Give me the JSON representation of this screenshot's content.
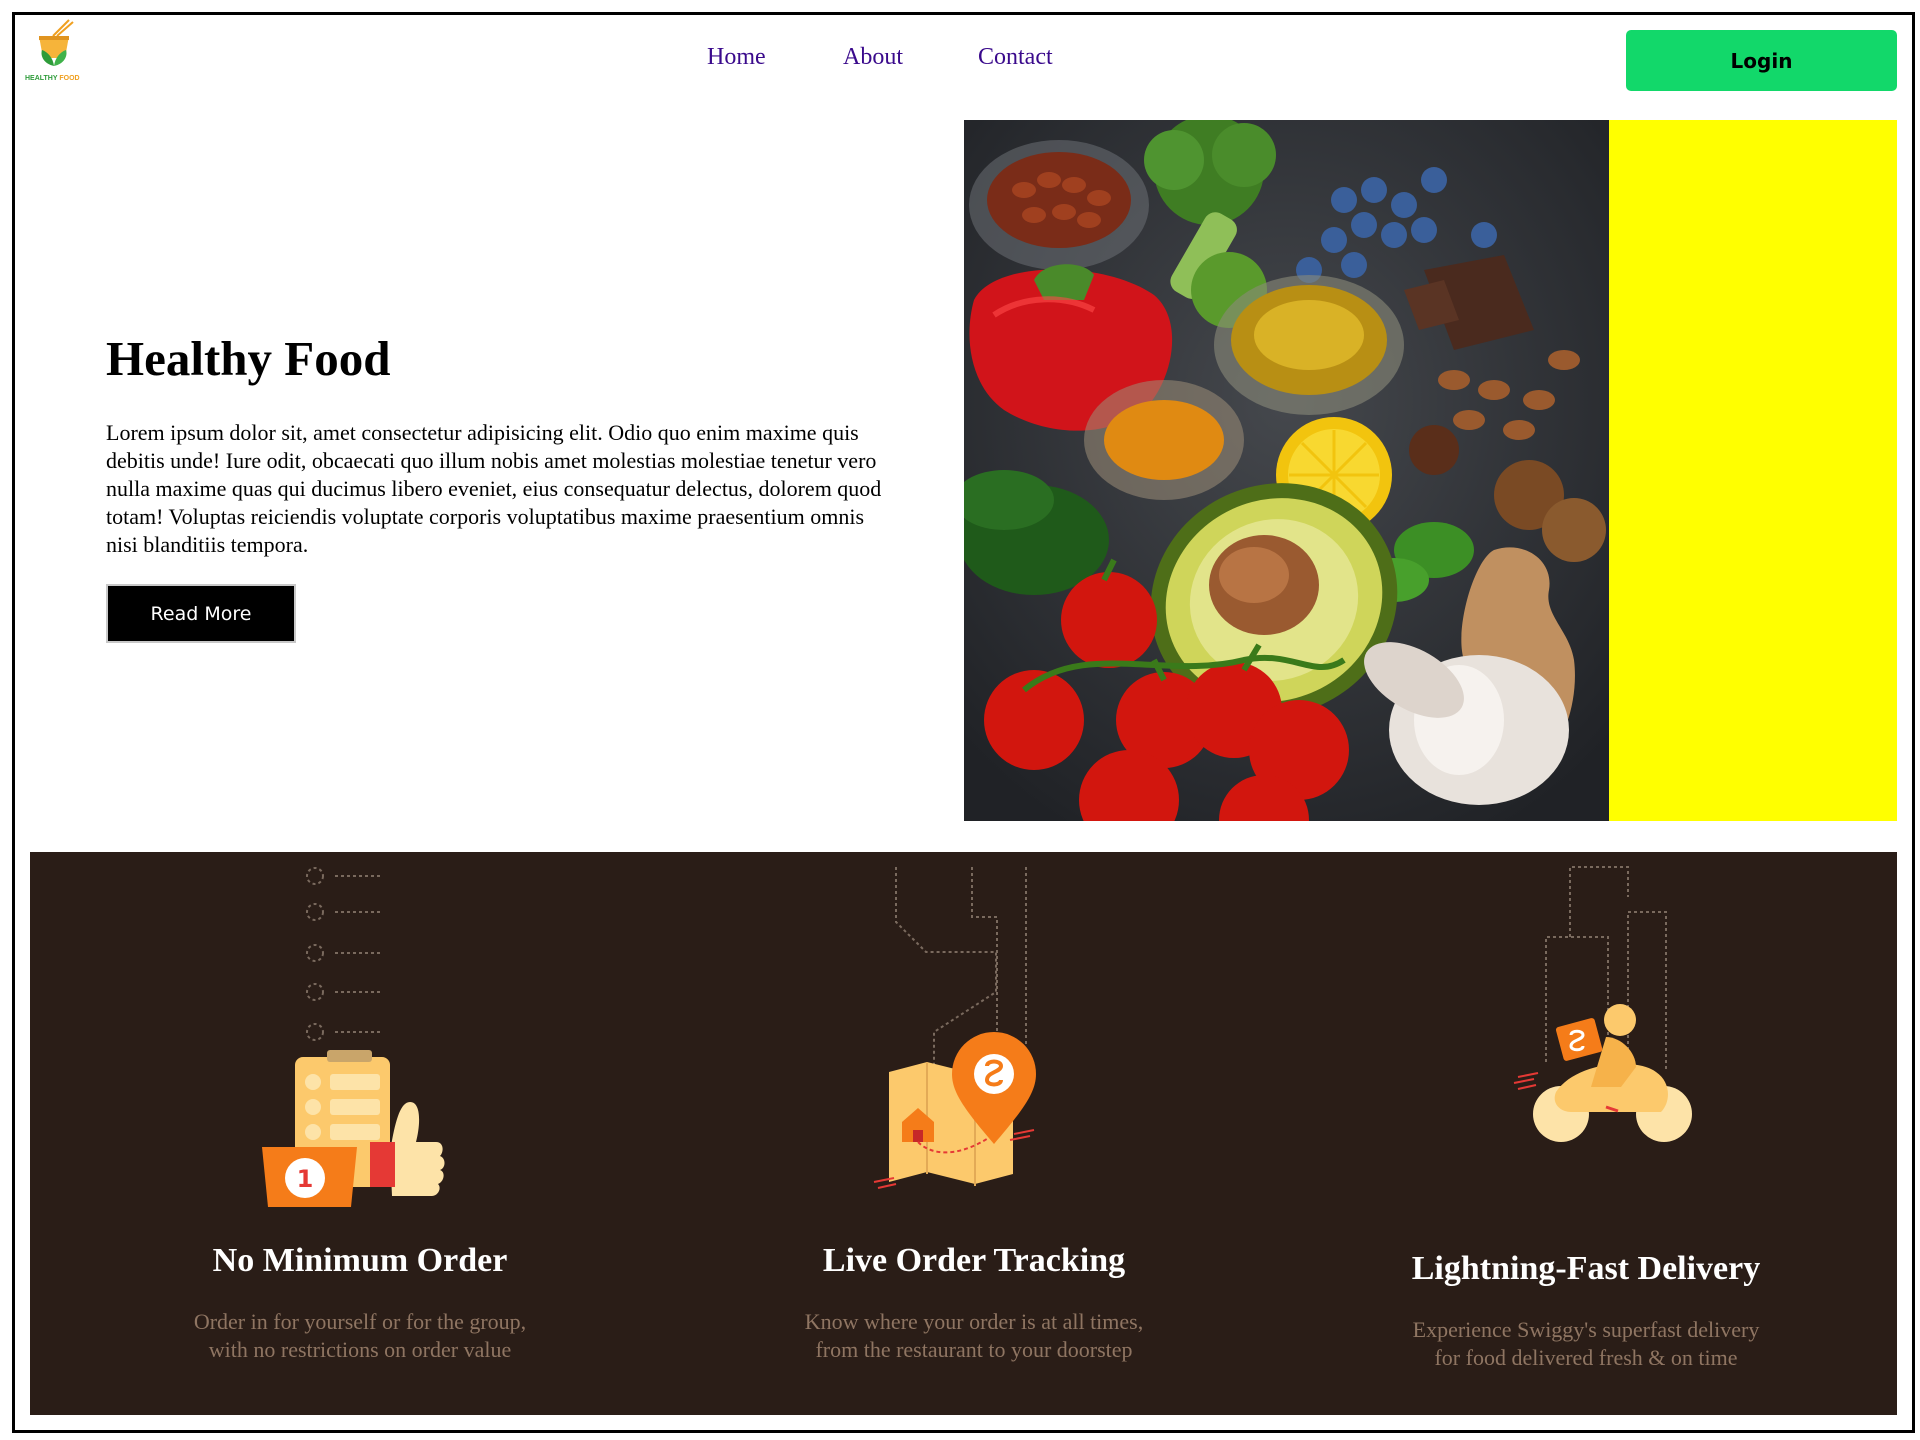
{
  "brand": {
    "logo_alt": "Healthy Food logo",
    "logo_text_1": "HEALTHY",
    "logo_text_2": "FOOD"
  },
  "nav": {
    "items": [
      {
        "label": "Home"
      },
      {
        "label": "About"
      },
      {
        "label": "Contact"
      }
    ],
    "login_label": "Login"
  },
  "hero": {
    "title": "Healthy Food",
    "body": "Lorem ipsum dolor sit, amet consectetur adipisicing elit. Odio quo enim maxime quis debitis unde! Iure odit, obcaecati quo illum nobis amet molestias molestiae tenetur vero nulla maxime quas qui ducimus libero eveniet, eius consequatur delectus, dolorem quod totam! Voluptas reiciendis voluptate corporis voluptatibus maxime praesentium omnis nisi blanditiis tempora.",
    "read_more_label": "Read More",
    "image_desc": "vegetables-nuts-spices-photo"
  },
  "features": [
    {
      "icon": "clipboard-thumbs-up-icon",
      "title": "No Minimum Order",
      "desc_line1": "Order in for yourself or for the group,",
      "desc_line2": "with no restrictions on order value"
    },
    {
      "icon": "map-pin-icon",
      "title": "Live Order Tracking",
      "desc_line1": "Know where your order is at all times,",
      "desc_line2": "from the restaurant to your doorstep"
    },
    {
      "icon": "delivery-scooter-icon",
      "title": "Lightning-Fast Delivery",
      "desc_line1": "Experience Swiggy's superfast delivery",
      "desc_line2": "for food delivered fresh & on time"
    }
  ],
  "colors": {
    "login_green": "#12d86a",
    "nav_link": "#3a0a8c",
    "features_bg": "#2a1d17",
    "accent_yellow": "#ffff00",
    "feature_desc": "#8f7562",
    "icon_orange": "#f57c19"
  }
}
